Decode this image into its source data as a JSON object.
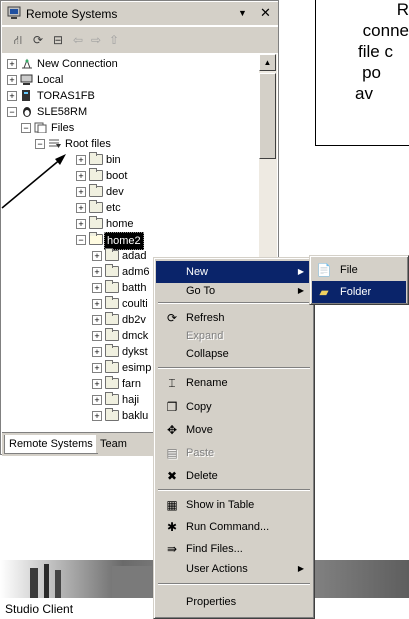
{
  "panel": {
    "title": "Remote Systems",
    "tabs": [
      "Remote Systems",
      "Team"
    ],
    "view_menu_icon": "chevron-down-icon",
    "close_icon": "close-icon"
  },
  "tree": {
    "items": [
      {
        "label": "New Connection",
        "icon": "new-connection-icon"
      },
      {
        "label": "Local",
        "icon": "local-system-icon"
      },
      {
        "label": "TORAS1FB",
        "icon": "iseries-system-icon"
      },
      {
        "label": "SLE58RM",
        "icon": "linux-system-icon"
      },
      {
        "label": "Files",
        "icon": "files-subsystem-icon"
      },
      {
        "label": "Root files",
        "icon": "filter-icon"
      },
      {
        "label": "bin"
      },
      {
        "label": "boot"
      },
      {
        "label": "dev"
      },
      {
        "label": "etc"
      },
      {
        "label": "home"
      },
      {
        "label": "home2"
      },
      {
        "label": "adad"
      },
      {
        "label": "adm6"
      },
      {
        "label": "batth"
      },
      {
        "label": "coulti"
      },
      {
        "label": "db2v"
      },
      {
        "label": "dmck"
      },
      {
        "label": "dykst"
      },
      {
        "label": "esimp"
      },
      {
        "label": "farn"
      },
      {
        "label": "haji"
      },
      {
        "label": "baklu"
      }
    ]
  },
  "callout": {
    "lines": [
      "R",
      "conne",
      "file c",
      "po",
      "av"
    ]
  },
  "context_menu": {
    "items": [
      {
        "label": "New",
        "submenu": true,
        "highlighted": true
      },
      {
        "label": "Go To",
        "submenu": true
      },
      {
        "label": "Refresh",
        "icon": "refresh-icon"
      },
      {
        "label": "Expand",
        "disabled": true
      },
      {
        "label": "Collapse"
      },
      {
        "label": "Rename",
        "icon": "rename-icon"
      },
      {
        "label": "Copy",
        "icon": "copy-icon"
      },
      {
        "label": "Move",
        "icon": "move-icon"
      },
      {
        "label": "Paste",
        "icon": "paste-icon",
        "disabled": true
      },
      {
        "label": "Delete",
        "icon": "delete-icon"
      },
      {
        "label": "Show in Table",
        "icon": "table-icon"
      },
      {
        "label": "Run Command...",
        "icon": "run-command-icon"
      },
      {
        "label": "Find Files...",
        "icon": "find-files-icon"
      },
      {
        "label": "User Actions",
        "submenu": true
      },
      {
        "label": "Properties"
      }
    ]
  },
  "submenu": {
    "items": [
      {
        "label": "File",
        "icon": "new-file-icon"
      },
      {
        "label": "Folder",
        "icon": "new-folder-icon",
        "highlighted": true
      }
    ]
  },
  "footer": {
    "caption": "Studio Client"
  },
  "colors": {
    "menu_bg": "#d4d0c8",
    "highlight": "#0a246a",
    "disabled_text": "#808080"
  }
}
